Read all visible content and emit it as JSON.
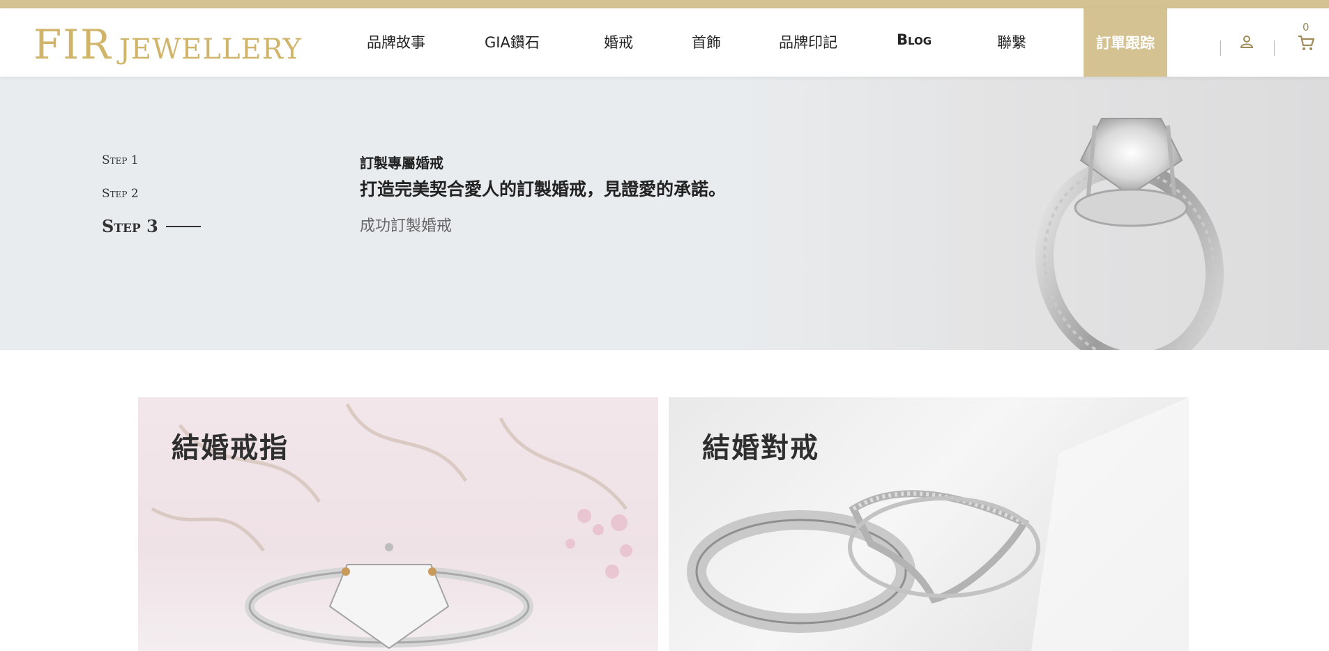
{
  "brand": {
    "logo_main": "FIR",
    "logo_sub": "JEWELLERY"
  },
  "nav": {
    "items": [
      {
        "label": "品牌故事"
      },
      {
        "label": "GIA鑽石"
      },
      {
        "label": "婚戒"
      },
      {
        "label": "首飾"
      },
      {
        "label": "品牌印記"
      },
      {
        "label": "Blog"
      },
      {
        "label": "聯繫"
      }
    ],
    "track_label": "訂單跟踪",
    "cart_count": "0",
    "user_icon": "user-icon",
    "cart_icon": "cart-icon"
  },
  "hero": {
    "steps": [
      {
        "label": "Step 1"
      },
      {
        "label": "Step 2"
      },
      {
        "label": "Step 3"
      }
    ],
    "title": "訂製專屬婚戒",
    "subtitle": "打造完美契合愛人的訂製婚戒，見證愛的承諾。",
    "done_text": "成功訂製婚戒"
  },
  "cards": [
    {
      "title": "結婚戒指"
    },
    {
      "title": "結婚對戒"
    }
  ],
  "colors": {
    "accent": "#d4c293",
    "logo": "#cfb46a",
    "hero_bg": "#e8ecef"
  }
}
